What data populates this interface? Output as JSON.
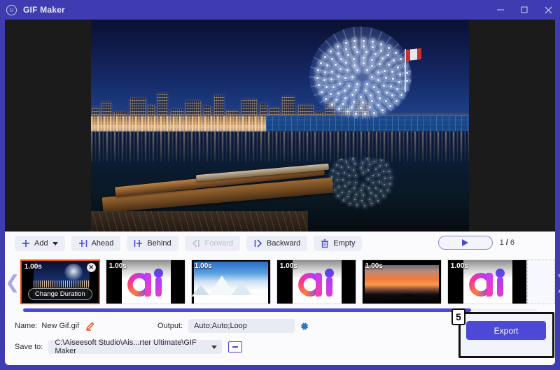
{
  "window": {
    "title": "GIF Maker",
    "app_icon": "gif-smiley-icon",
    "accent": "#4b49d6",
    "titlebar_bg": "#3f3bb0",
    "controls": {
      "minimize": "minimize-icon",
      "maximize": "maximize-icon",
      "close": "close-icon"
    }
  },
  "preview": {
    "description": "Night photo of Vancouver Science World geodesic dome with city skyline, wooden canoes on a dock and water reflections"
  },
  "toolbar": {
    "buttons": [
      {
        "label": "Add",
        "icon": "plus-icon",
        "disabled": false,
        "has_caret": true
      },
      {
        "label": "Ahead",
        "icon": "insert-ahead-icon",
        "disabled": false,
        "has_caret": false
      },
      {
        "label": "Behind",
        "icon": "insert-behind-icon",
        "disabled": false,
        "has_caret": false
      },
      {
        "label": "Forward",
        "icon": "move-forward-icon",
        "disabled": true,
        "has_caret": false
      },
      {
        "label": "Backward",
        "icon": "move-backward-icon",
        "disabled": false,
        "has_caret": false
      },
      {
        "label": "Empty",
        "icon": "trash-icon",
        "disabled": false,
        "has_caret": false
      }
    ],
    "play_icon": "play-icon",
    "counter_current": "1",
    "counter_sep": "/",
    "counter_total": "6"
  },
  "strip": {
    "prev_icon": "chevron-left-icon",
    "next_icon": "chevron-right-icon",
    "selected_index": 0,
    "change_duration_label": "Change Duration",
    "close_icon": "close-thumb-icon",
    "frames": [
      {
        "duration": "1.00s",
        "art": "city",
        "selected": true
      },
      {
        "duration": "1.00s",
        "art": "ai",
        "selected": false
      },
      {
        "duration": "1.00s",
        "art": "snow",
        "selected": false
      },
      {
        "duration": "1.00s",
        "art": "ai",
        "selected": false
      },
      {
        "duration": "1.00s",
        "art": "sunset",
        "selected": false
      },
      {
        "duration": "1.00s",
        "art": "ai",
        "selected": false
      }
    ]
  },
  "fields": {
    "name_label": "Name:",
    "name_value": "New Gif.gif",
    "edit_icon": "pencil-icon",
    "output_label": "Output:",
    "output_value": "Auto;Auto;Loop",
    "settings_icon": "gear-icon",
    "save_label": "Save to:",
    "save_value": "C:\\Aiseesoft Studio\\Ais...rter Ultimate\\GIF Maker",
    "dropdown_icon": "chevron-down-icon",
    "browse_icon": "folder-icon"
  },
  "export": {
    "label": "Export",
    "callout_number": "5"
  }
}
